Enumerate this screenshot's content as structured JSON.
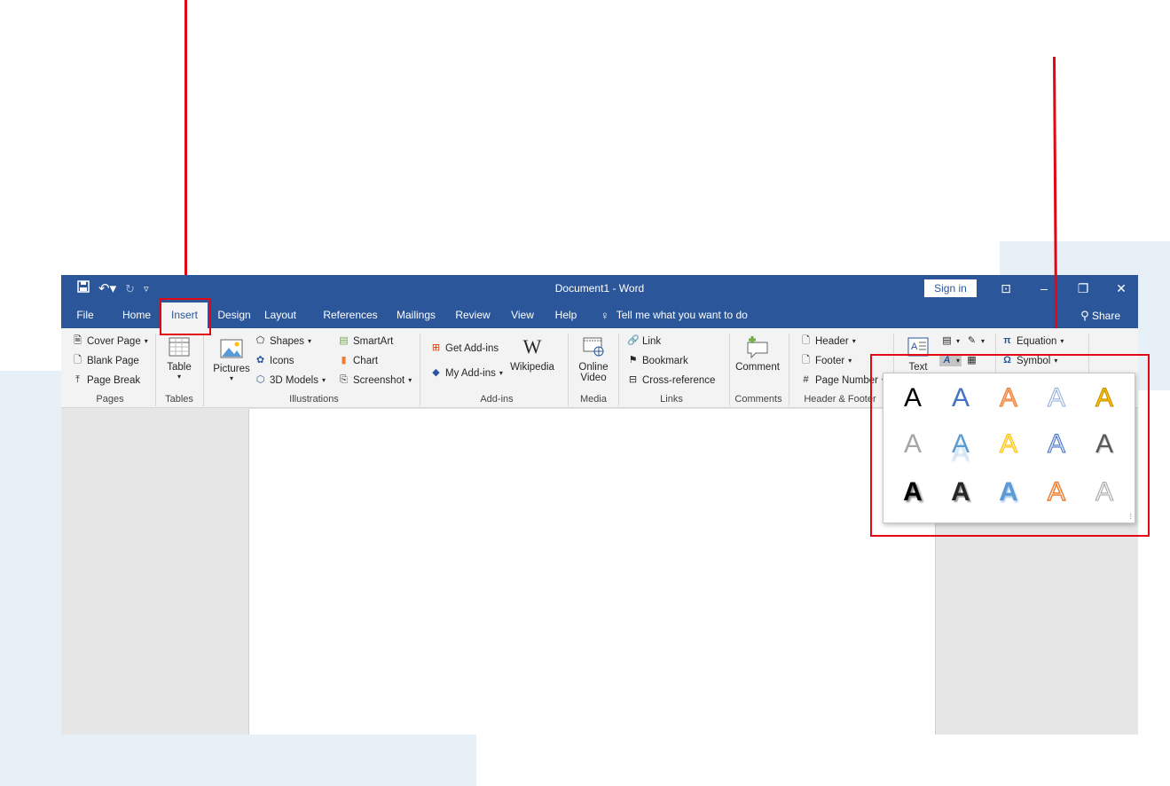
{
  "colors": {
    "accent": "#2b579a",
    "annotation": "#e30613",
    "ribbon_bg": "#f3f3f3"
  },
  "titlebar": {
    "qat_icons": [
      "save-icon",
      "undo-icon",
      "redo-icon",
      "customize-icon"
    ],
    "title": "Document1  -  Word",
    "sign_in": "Sign in",
    "ribbon_display_icon": "ribbon-display-icon",
    "minimize_icon": "minimize-icon",
    "restore_icon": "restore-icon",
    "close_icon": "close-icon"
  },
  "tabs": [
    "File",
    "Home",
    "Insert",
    "Design",
    "Layout",
    "References",
    "Mailings",
    "Review",
    "View",
    "Help"
  ],
  "active_tab": "Insert",
  "tell_me": "Tell me what you want to do",
  "share": "Share",
  "ribbon": {
    "pages": {
      "label": "Pages",
      "items": [
        "Cover Page",
        "Blank Page",
        "Page Break"
      ]
    },
    "tables": {
      "label": "Tables",
      "table": "Table"
    },
    "illustrations": {
      "label": "Illustrations",
      "pictures": "Pictures",
      "shapes": "Shapes",
      "icons": "Icons",
      "models": "3D Models",
      "smartart": "SmartArt",
      "chart": "Chart",
      "screenshot": "Screenshot"
    },
    "addins": {
      "label": "Add-ins",
      "get": "Get Add-ins",
      "my": "My Add-ins",
      "wikipedia": "Wikipedia",
      "w_glyph": "W"
    },
    "media": {
      "label": "Media",
      "online_video": "Online",
      "online_video2": "Video"
    },
    "links": {
      "label": "Links",
      "link": "Link",
      "bookmark": "Bookmark",
      "crossref": "Cross-reference"
    },
    "comments": {
      "label": "Comments",
      "comment": "Comment"
    },
    "header_footer": {
      "label": "Header & Footer",
      "header": "Header",
      "footer": "Footer",
      "page_number": "Page Number"
    },
    "text": {
      "textbox": "Text"
    },
    "symbols": {
      "equation": "Equation",
      "symbol": "Symbol"
    }
  },
  "wordart_gallery": {
    "glyph": "A"
  }
}
